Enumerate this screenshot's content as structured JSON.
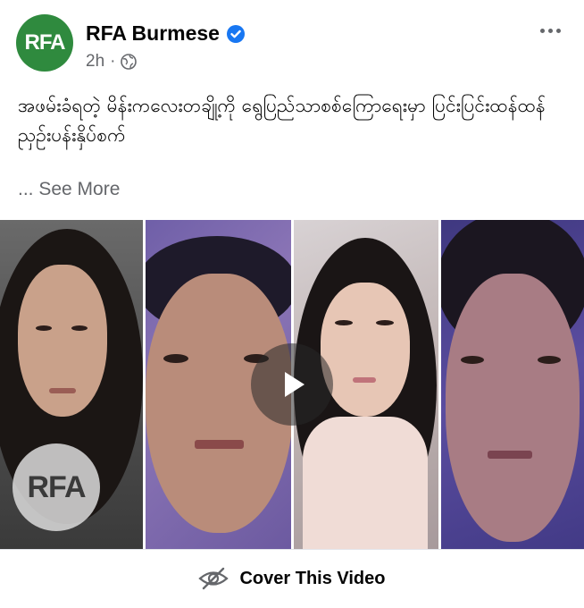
{
  "post": {
    "avatar_text": "RFA",
    "page_name": "RFA Burmese",
    "time": "2h",
    "separator": "·",
    "text": "အဖမ်းခံရတဲ့ မိန်းကလေးတချို့ကို ရွေပြည်သာစစ်ကြောရေးမှာ ပြင်းပြင်းထန်ထန် ညှဉ်းပန်းနှိပ်စက်",
    "see_more": "... See More"
  },
  "video": {
    "watermark": "RFA",
    "cover_label": "Cover This Video"
  },
  "icons": {
    "verified": "verified-badge-icon",
    "globe": "globe-icon",
    "more": "more-options-icon",
    "play": "play-icon",
    "eye_slash": "eye-slash-icon"
  },
  "colors": {
    "avatar_bg": "#2f8a3e",
    "verified_blue": "#1877f2",
    "secondary_text": "#65676b"
  }
}
